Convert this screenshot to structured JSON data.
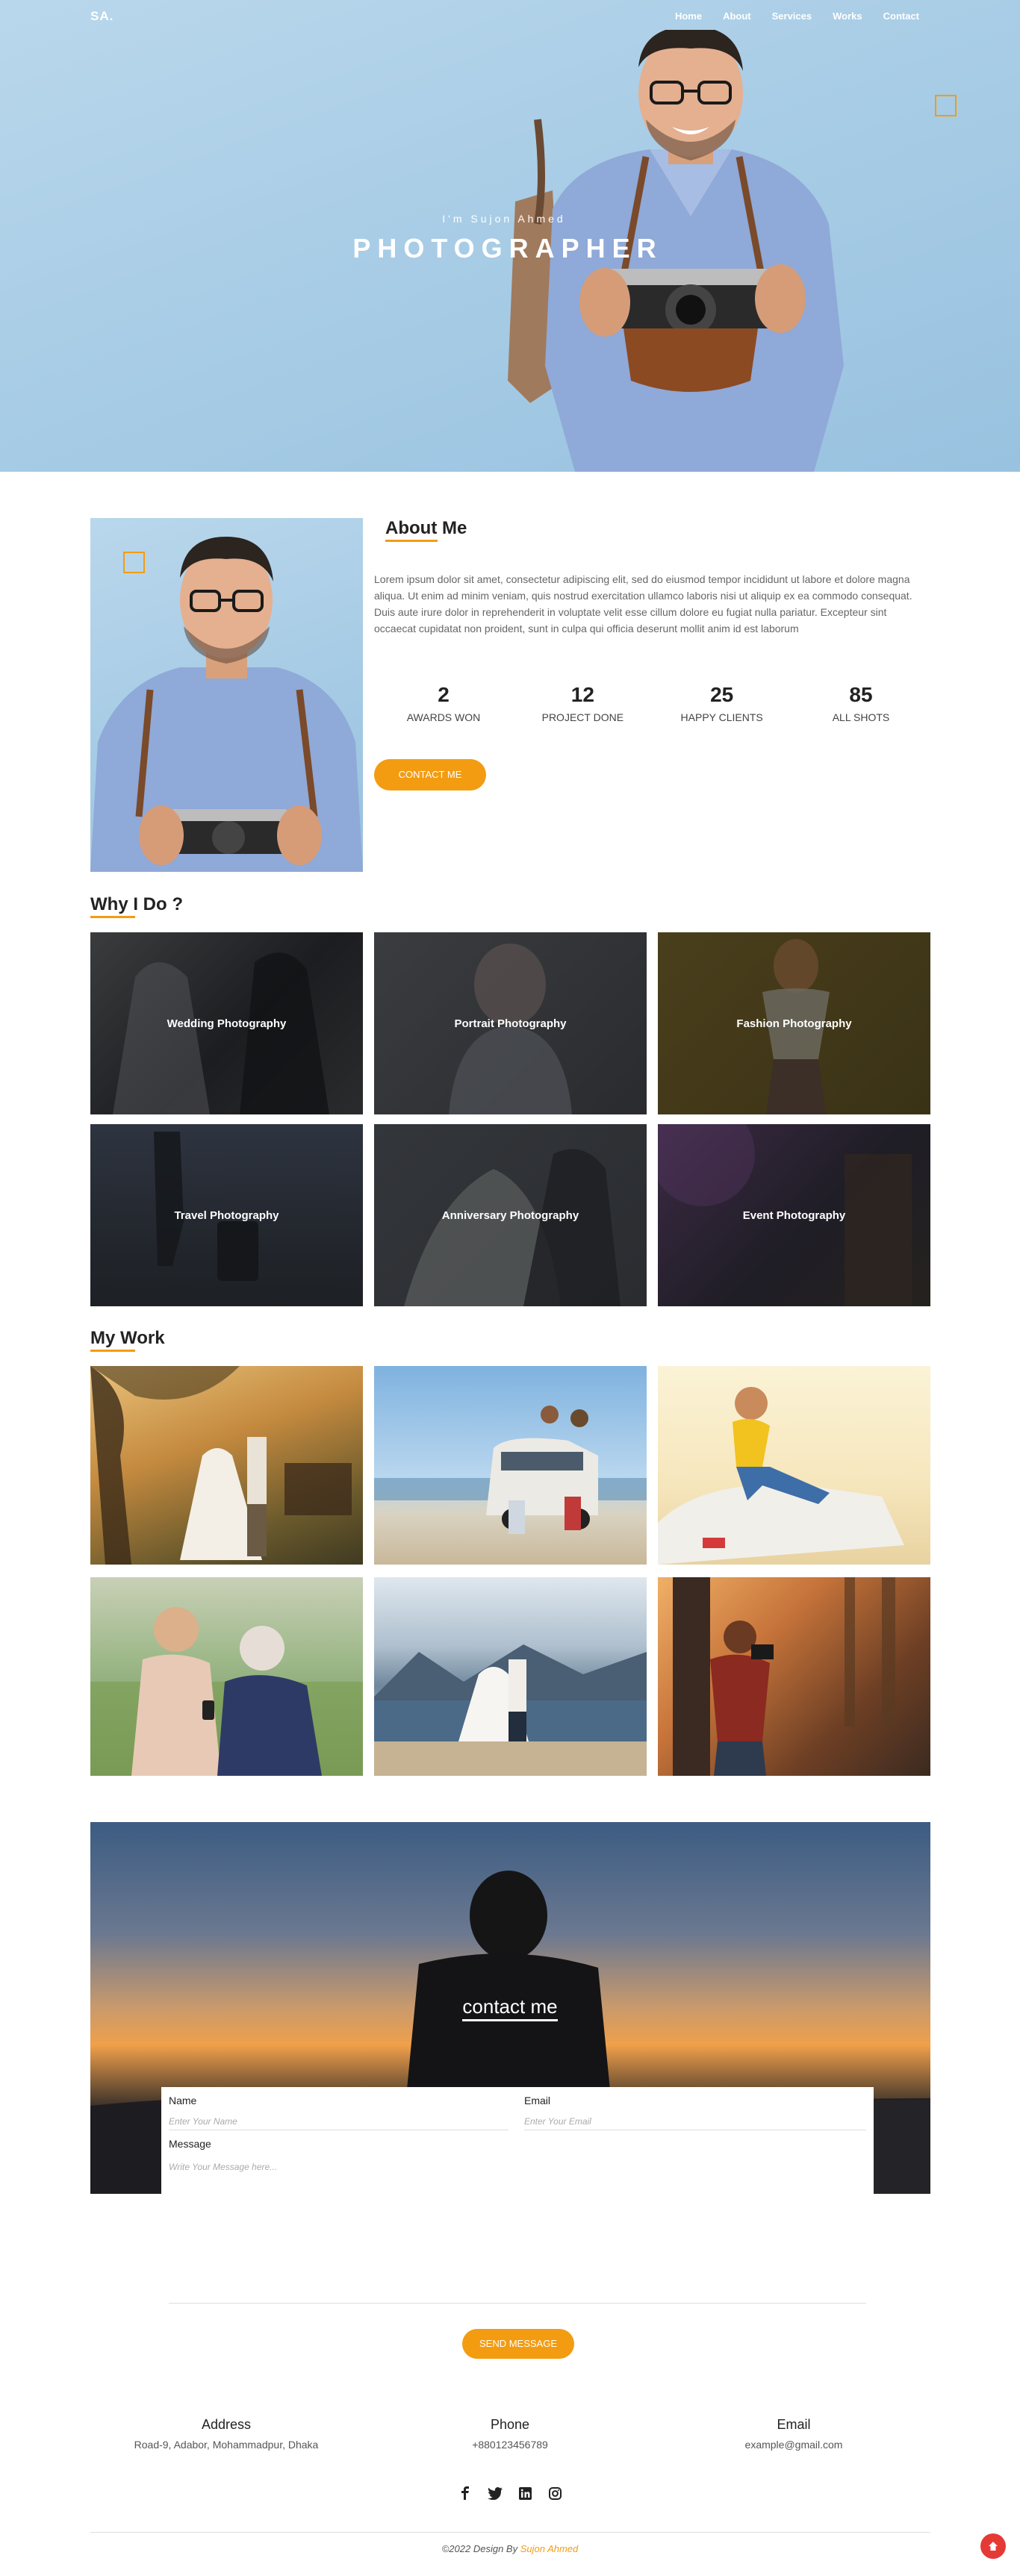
{
  "brand": {
    "logo": "SA.",
    "accent": "#f39c12"
  },
  "nav": {
    "items": [
      "Home",
      "About",
      "Services",
      "Works",
      "Contact"
    ]
  },
  "hero": {
    "subtitle": "I'm Sujon Ahmed",
    "title": "PHOTOGRAPHER"
  },
  "about": {
    "heading": "About Me",
    "paragraph": "Lorem ipsum dolor sit amet, consectetur adipiscing elit, sed do eiusmod tempor incididunt ut labore et dolore magna aliqua. Ut enim ad minim veniam, quis nostrud exercitation ullamco laboris nisi ut aliquip ex ea commodo consequat. Duis aute irure dolor in reprehenderit in voluptate velit esse cillum dolore eu fugiat nulla pariatur. Excepteur sint occaecat cupidatat non proident, sunt in culpa qui officia deserunt mollit anim id est laborum",
    "stats": [
      {
        "value": "2",
        "label": "AWARDS WON"
      },
      {
        "value": "12",
        "label": "PROJECT DONE"
      },
      {
        "value": "25",
        "label": "HAPPY CLIENTS"
      },
      {
        "value": "85",
        "label": "ALL SHOTS"
      }
    ],
    "contact_button": "CONTACT ME"
  },
  "services": {
    "heading": "Why I Do ?",
    "items": [
      {
        "label": "Wedding Photography"
      },
      {
        "label": "Portrait Photography"
      },
      {
        "label": "Fashion Photography"
      },
      {
        "label": "Travel Photography"
      },
      {
        "label": "Anniversary Photography"
      },
      {
        "label": "Event Photography"
      }
    ]
  },
  "works": {
    "heading": "My Work"
  },
  "contact": {
    "title": "contact me",
    "name_label": "Name",
    "name_placeholder": "Enter Your Name",
    "email_label": "Email",
    "email_placeholder": "Enter Your Email",
    "message_label": "Message",
    "message_placeholder": "Write Your Message here...",
    "send_button": "SEND MESSAGE"
  },
  "footer": {
    "address_label": "Address",
    "address_value": "Road-9, Adabor, Mohammadpur, Dhaka",
    "phone_label": "Phone",
    "phone_value": "+880123456789",
    "email_label": "Email",
    "email_value": "example@gmail.com",
    "social_icons": [
      "facebook-icon",
      "twitter-icon",
      "linkedin-icon",
      "instagram-icon"
    ],
    "copyright_prefix": "©2022 Design By ",
    "copyright_name": "Sujon Ahmed"
  }
}
